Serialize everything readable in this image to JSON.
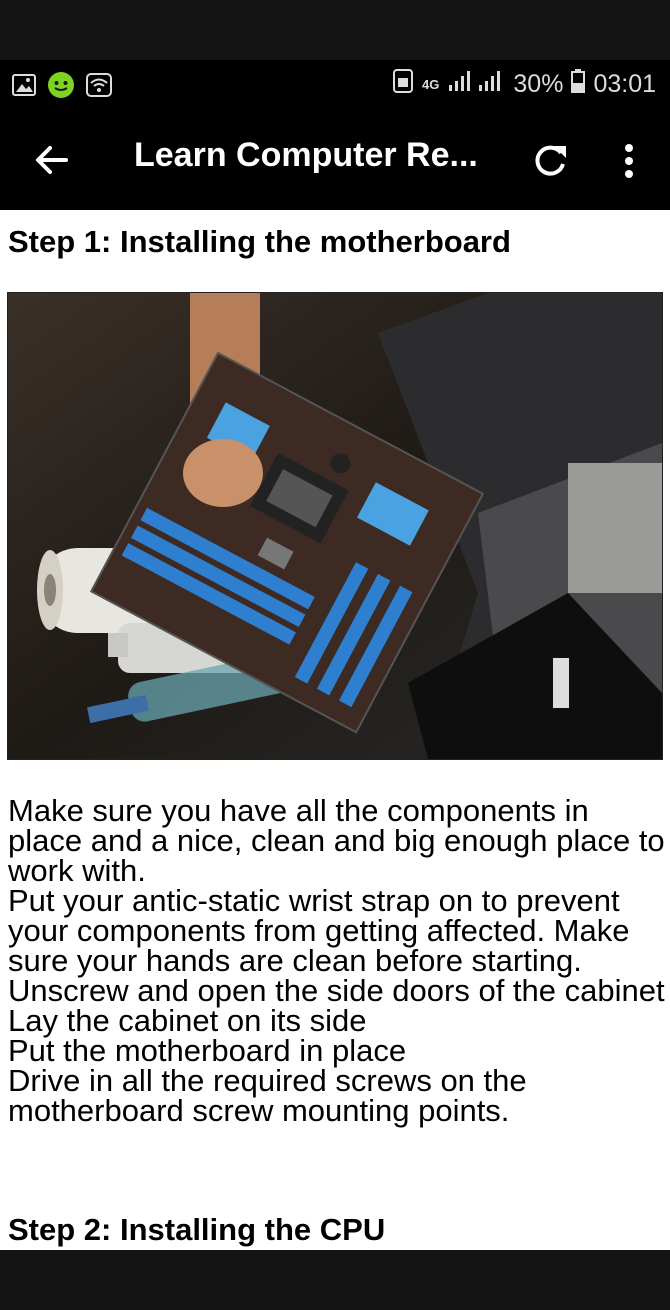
{
  "status_bar": {
    "icons_left": [
      "image-icon",
      "android-icon",
      "wifi-icon"
    ],
    "network": "4G",
    "battery": "30%",
    "time": "03:01"
  },
  "app_bar": {
    "title": "Learn Computer Re...",
    "back_icon": "arrow-left-icon",
    "refresh_icon": "refresh-icon",
    "menu_icon": "more-vertical-icon"
  },
  "article": {
    "step1_heading": "Step 1: Installing the motherboard",
    "step1_lines": [
      "Make sure you have all the components in place and a nice, clean and big enough place to work with.",
      "Put your antic-static wrist strap on to prevent your components from getting affected. Make sure your hands are clean before starting.",
      "Unscrew and open the side doors of the cabinet",
      "Lay the cabinet on its side",
      "Put the motherboard in place",
      "Drive in all the required screws on the motherboard screw mounting points."
    ],
    "step2_heading": "Step 2: Installing the CPU"
  }
}
